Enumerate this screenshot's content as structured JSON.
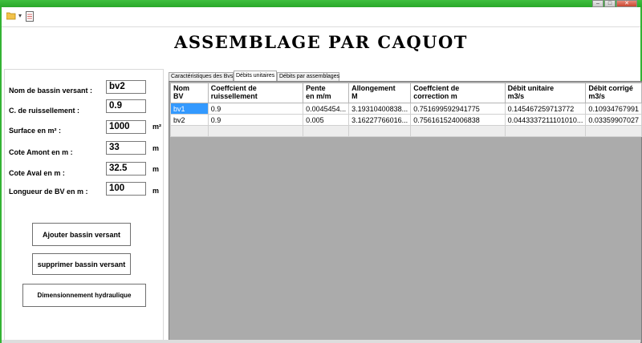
{
  "window": {
    "minimize": "–",
    "maximize": "□",
    "close": "✕"
  },
  "toolbar": {
    "open_icon": "folder-icon",
    "dropdown_icon": "chevron-down-icon",
    "doc_icon": "document-icon",
    "dropdown_glyph": "▾"
  },
  "title": "ASSEMBLAGE PAR CAQUOT",
  "form": {
    "nom_label": "Nom de bassin versant :",
    "nom_value": "bv2",
    "c_label": "C. de ruissellement :",
    "c_value": "0.9",
    "surface_label": "Surface en m² :",
    "surface_value": "1000",
    "surface_unit": "m²",
    "amont_label": "Cote Amont en m :",
    "amont_value": "33",
    "amont_unit": "m",
    "aval_label": "Cote Aval en m :",
    "aval_value": "32.5",
    "aval_unit": "m",
    "longueur_label": "Longueur de BV en m :",
    "longueur_value": "100",
    "longueur_unit": "m"
  },
  "buttons": {
    "ajouter": "Ajouter bassin versant",
    "supprimer": "supprimer bassin versant",
    "dimensionnement": "Dimensionnement hydraulique"
  },
  "tabs": [
    {
      "label": "Caractéristiques des Bvs"
    },
    {
      "label": "Débits unitaires"
    },
    {
      "label": "Débits par assemblages"
    }
  ],
  "grid": {
    "columns": [
      {
        "line1": "Nom",
        "line2": "BV"
      },
      {
        "line1": "Coeffcient de",
        "line2": "ruissellement"
      },
      {
        "line1": "Pente",
        "line2": "en m/m"
      },
      {
        "line1": "Allongement",
        "line2": "M"
      },
      {
        "line1": "Coeffcient de",
        "line2": "correction m"
      },
      {
        "line1": "Débit unitaire",
        "line2": "m3/s"
      },
      {
        "line1": "Débit corrigé",
        "line2": "m3/s"
      }
    ],
    "rows": [
      [
        "bv1",
        "0.9",
        "0.0045454...",
        "3.19310400838...",
        "0.751699592941775",
        "0.145467259713772",
        "0.10934767991"
      ],
      [
        "bv2",
        "0.9",
        "0.005",
        "3.16227766016...",
        "0.756161524006838",
        "0.0443337211101010...",
        "0.03359907027"
      ]
    ]
  },
  "colors": {
    "titlebar": "#2aa82a",
    "selection": "#3399ff",
    "grid_bg": "#ababab"
  }
}
